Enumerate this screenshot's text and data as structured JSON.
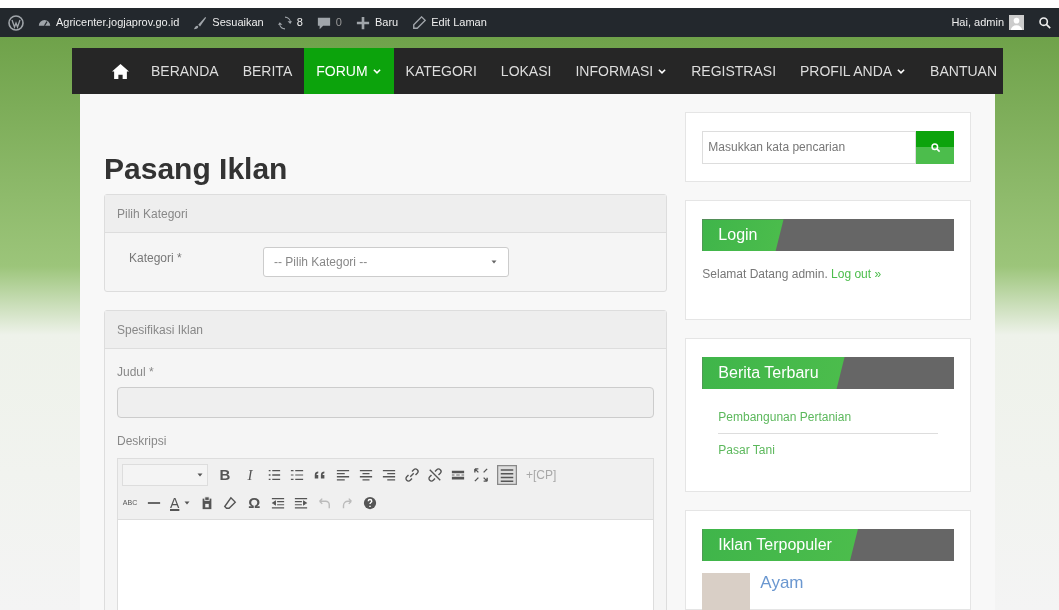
{
  "admin_bar": {
    "site": "Agricenter.jogjaprov.go.id",
    "items": [
      {
        "kind": "brush",
        "label": "Sesuaikan"
      },
      {
        "kind": "updates",
        "label": "8"
      },
      {
        "kind": "comments",
        "label": "0"
      },
      {
        "kind": "plus",
        "label": "Baru"
      },
      {
        "kind": "pencil",
        "label": "Edit Laman"
      }
    ],
    "greeting": "Hai, admin"
  },
  "nav": [
    {
      "label": "BERANDA",
      "selected": false,
      "dropdown": false
    },
    {
      "label": "BERITA",
      "selected": false,
      "dropdown": false
    },
    {
      "label": "FORUM",
      "selected": true,
      "dropdown": true
    },
    {
      "label": "KATEGORI",
      "selected": false,
      "dropdown": false
    },
    {
      "label": "LOKASI",
      "selected": false,
      "dropdown": false
    },
    {
      "label": "INFORMASI",
      "selected": false,
      "dropdown": true
    },
    {
      "label": "REGISTRASI",
      "selected": false,
      "dropdown": false
    },
    {
      "label": "PROFIL ANDA",
      "selected": false,
      "dropdown": true
    },
    {
      "label": "BANTUAN",
      "selected": false,
      "dropdown": false
    }
  ],
  "page_title": "Pasang Iklan",
  "category_panel": {
    "heading": "Pilih Kategori",
    "label": "Kategori *",
    "select": "-- Pilih Kategori --"
  },
  "spec_panel": {
    "heading": "Spesifikasi Iklan",
    "title_label": "Judul *",
    "description_label": "Deskripsi",
    "toolbar_row_1": [
      {
        "kind": "format"
      },
      {
        "kind": "text",
        "label": "B"
      },
      {
        "kind": "text",
        "label": "I"
      },
      {
        "kind": "ul"
      },
      {
        "kind": "ol"
      },
      {
        "kind": "quote"
      },
      {
        "kind": "alignleft"
      },
      {
        "kind": "aligncenter"
      },
      {
        "kind": "alignright"
      },
      {
        "kind": "link"
      },
      {
        "kind": "unlink"
      },
      {
        "kind": "more"
      },
      {
        "kind": "fullscreen"
      },
      {
        "kind": "kitchen"
      },
      {
        "kind": "faint",
        "label": "+[CP]"
      }
    ],
    "toolbar_row_2": [
      {
        "kind": "text",
        "label": "ABC"
      },
      {
        "kind": "hr"
      },
      {
        "kind": "textcolor",
        "label": "A"
      },
      {
        "kind": "paste"
      },
      {
        "kind": "eraser"
      },
      {
        "kind": "text",
        "label": "Ω"
      },
      {
        "kind": "outdent"
      },
      {
        "kind": "indent"
      },
      {
        "kind": "undo"
      },
      {
        "kind": "redo"
      },
      {
        "kind": "help"
      }
    ]
  },
  "search": {
    "placeholder": "Masukkan kata pencarian"
  },
  "login_widget": {
    "title": "Login",
    "text": "Selamat Datang admin.",
    "link": "Log out »"
  },
  "news_widget": {
    "title": "Berita Terbaru",
    "items": [
      "Pembangunan Pertanian",
      "Pasar Tani"
    ]
  },
  "popular_widget": {
    "title": "Iklan Terpopuler",
    "items": [
      "Ayam"
    ]
  }
}
